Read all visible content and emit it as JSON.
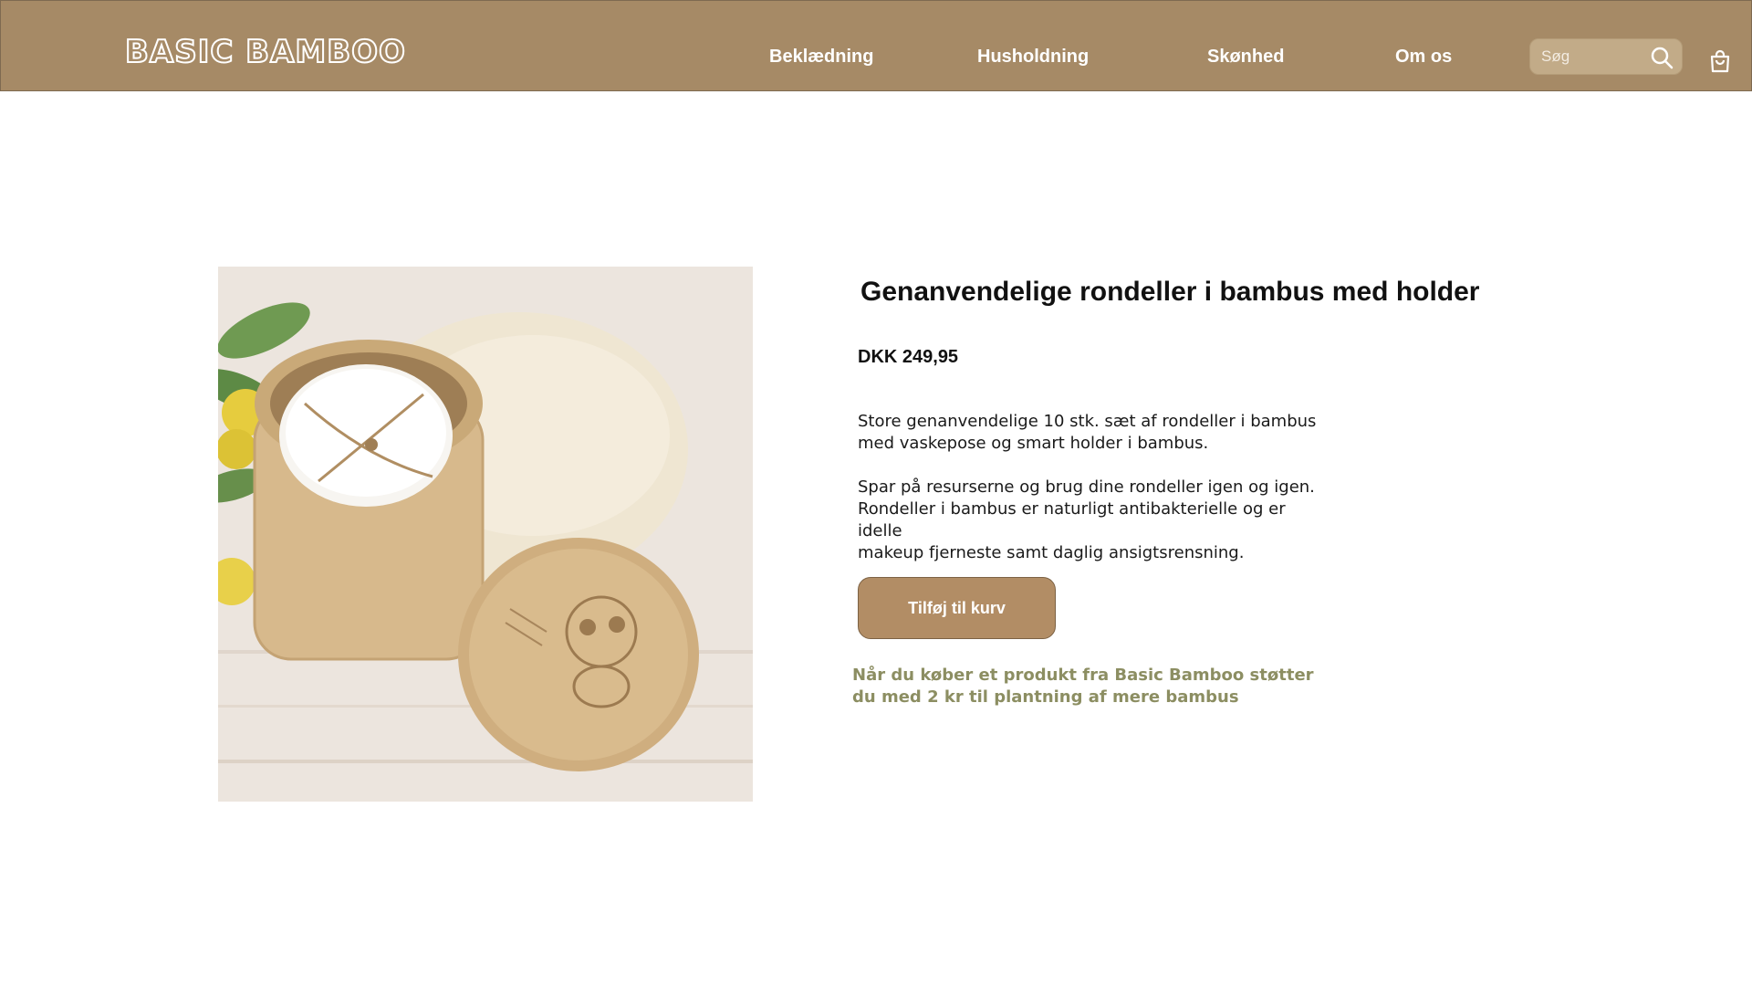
{
  "header": {
    "logo": "BASIC BAMBOO",
    "nav": [
      "Beklædning",
      "Husholdning",
      "Skønhed",
      "Om os"
    ],
    "search_placeholder": "Søg",
    "search_icon": "search-icon",
    "cart_icon": "shopping-bag-icon"
  },
  "product": {
    "title": "Genanvendelige rondeller i bambus med holder",
    "price": "DKK 249,95",
    "description_1_line1": "Store genanvendelige 10 stk. sæt af rondeller i bambus",
    "description_1_line2": "med vaskepose og smart holder i bambus.",
    "description_2_line1": "Spar på resurserne og brug dine rondeller igen og igen.",
    "description_2_line2": "Rondeller i bambus er naturligt antibakterielle og er idelle",
    "description_2_line3": "makeup fjerneste samt daglig ansigtsrensning.",
    "add_to_cart_label": "Tilføj til kurv",
    "note_line1": "Når du køber et produkt fra Basic Bamboo støtter",
    "note_line2": "du med 2 kr til plantning af mere bambus"
  },
  "colors": {
    "header_bg": "#a68a66",
    "button_bg": "#b28d65",
    "note_text": "#8c8e62"
  }
}
